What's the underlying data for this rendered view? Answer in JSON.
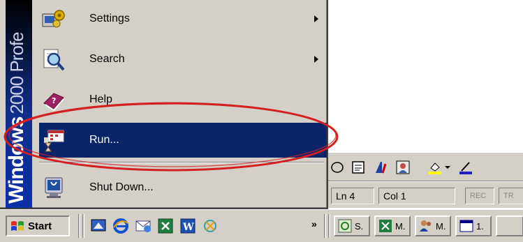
{
  "brand": {
    "word1": "Windows",
    "word2": "2000 Profe"
  },
  "start_menu": {
    "items": [
      {
        "label": "Settings",
        "icon": "settings-icon",
        "submenu": true
      },
      {
        "label": "Search",
        "icon": "search-icon",
        "submenu": true
      },
      {
        "label": "Help",
        "icon": "help-book-icon",
        "submenu": false
      },
      {
        "label": "Run...",
        "icon": "run-icon",
        "submenu": false,
        "highlighted": true
      },
      {
        "label": "Shut Down...",
        "icon": "shutdown-icon",
        "submenu": false
      }
    ]
  },
  "status_bar": {
    "line": "Ln 4",
    "column": "Col 1",
    "rec": "REC",
    "trk": "TR"
  },
  "taskbar": {
    "start_label": "Start",
    "overflow": "»",
    "tasks": [
      {
        "label": "S.",
        "icon": "sql-icon"
      },
      {
        "label": "M.",
        "icon": "excel-icon"
      },
      {
        "label": "M.",
        "icon": "users-icon"
      },
      {
        "label": "1.",
        "icon": "window-icon"
      }
    ]
  },
  "colors": {
    "highlight": "#0a246a",
    "annotation": "#d42020",
    "face": "#d4d0c8"
  }
}
